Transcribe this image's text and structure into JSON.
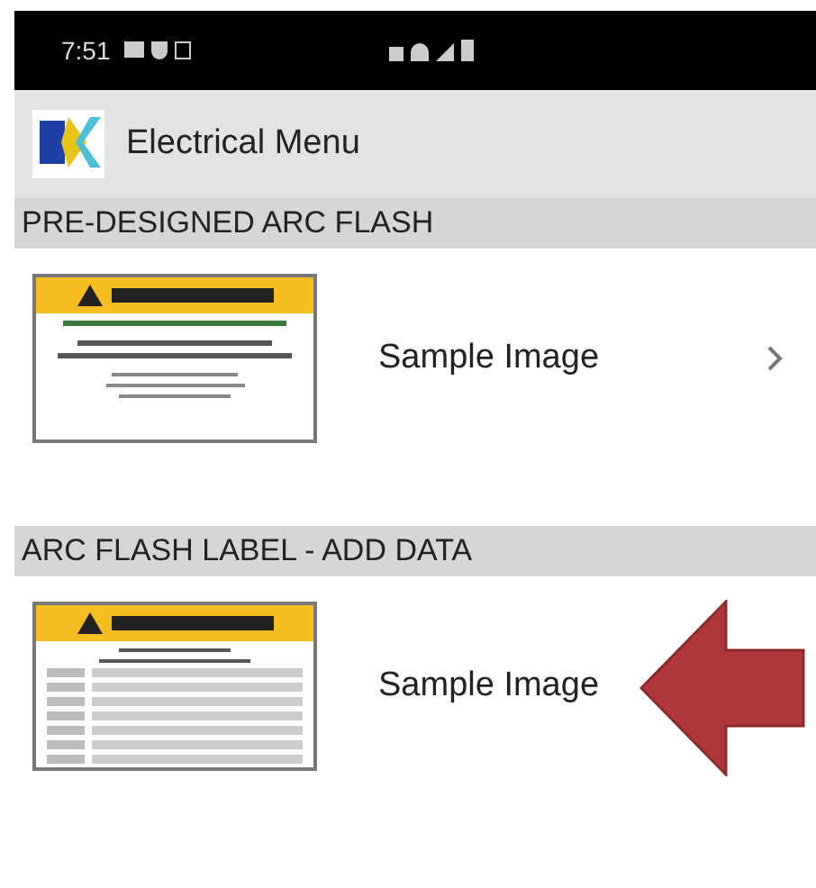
{
  "status_bar": {
    "time": "7:51"
  },
  "app_bar": {
    "title": "Electrical Menu"
  },
  "sections": [
    {
      "header": "PRE-DESIGNED ARC FLASH",
      "item": {
        "kind": "shock",
        "label": "Sample Image",
        "chevron": true
      }
    },
    {
      "header": "ARC FLASH LABEL - ADD DATA",
      "item": {
        "kind": "data",
        "label": "Sample Image",
        "chevron": false
      }
    }
  ]
}
